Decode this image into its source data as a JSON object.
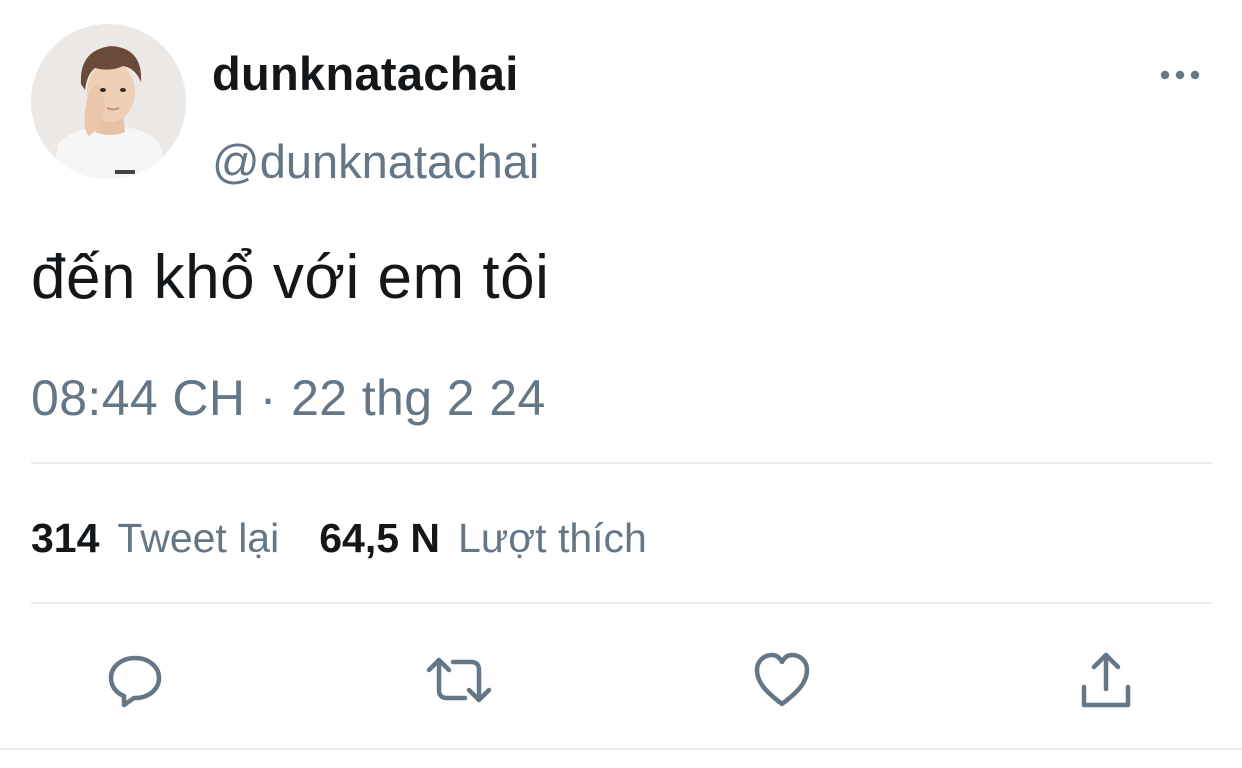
{
  "user": {
    "display_name": "dunknatachai",
    "handle": "@dunknatachai",
    "avatar_icon": "profile-photo"
  },
  "tweet": {
    "text": "đến khổ với em tôi",
    "timestamp": "08:44 CH · 22 thg 2 24"
  },
  "stats": {
    "retweets_count": "314",
    "retweets_label": "Tweet lại",
    "likes_count": "64,5 N",
    "likes_label": "Lượt thích"
  },
  "actions": {
    "reply_icon": "reply-icon",
    "retweet_icon": "retweet-icon",
    "like_icon": "heart-icon",
    "share_icon": "share-icon"
  },
  "colors": {
    "text_primary": "#14171a",
    "text_secondary": "#657786",
    "divider": "#e6ecf0"
  }
}
